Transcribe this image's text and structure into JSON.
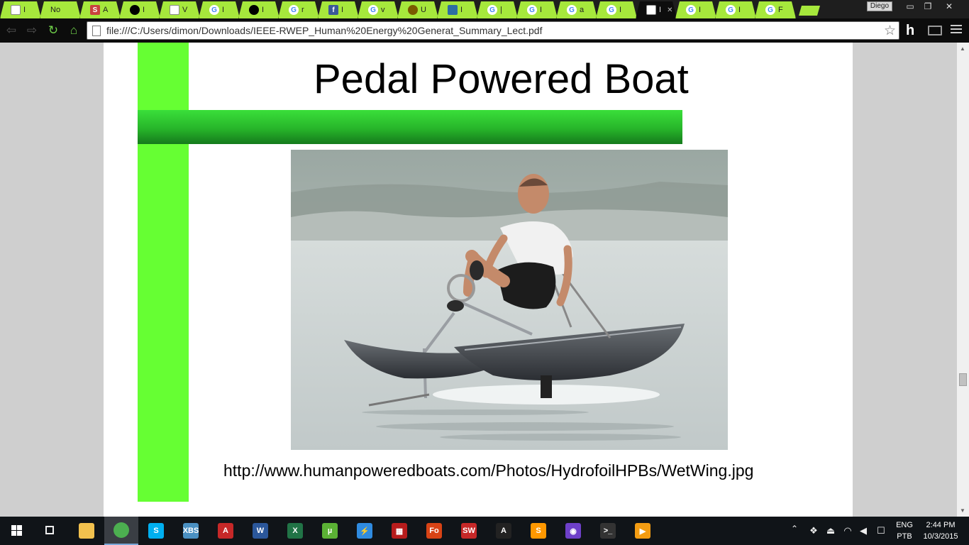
{
  "browser": {
    "tabs": [
      {
        "favicon": "document-icon",
        "title": "I"
      },
      {
        "favicon": "none",
        "title": "No"
      },
      {
        "favicon": "s-icon",
        "title": "A"
      },
      {
        "favicon": "github-icon",
        "title": "I"
      },
      {
        "favicon": "document-icon",
        "title": "V"
      },
      {
        "favicon": "google-icon",
        "title": "I"
      },
      {
        "favicon": "github-icon",
        "title": "I"
      },
      {
        "favicon": "google-icon",
        "title": "r"
      },
      {
        "favicon": "facebook-icon",
        "title": "I"
      },
      {
        "favicon": "google-icon",
        "title": "v"
      },
      {
        "favicon": "bug-icon",
        "title": "U"
      },
      {
        "favicon": "boat-icon",
        "title": "I"
      },
      {
        "favicon": "google-icon",
        "title": "|"
      },
      {
        "favicon": "google-icon",
        "title": "I"
      },
      {
        "favicon": "google-icon",
        "title": "a"
      },
      {
        "favicon": "google-icon",
        "title": "I"
      },
      {
        "favicon": "document-icon",
        "title": "I",
        "active": true
      },
      {
        "favicon": "google-icon",
        "title": "I"
      },
      {
        "favicon": "google-icon",
        "title": "I"
      },
      {
        "favicon": "google-icon",
        "title": "F"
      }
    ],
    "profile_name": "Diego",
    "address": "file:///C:/Users/dimon/Downloads/IEEE-RWEP_Human%20Energy%20Generat_Summary_Lect.pdf",
    "extension_label": "h"
  },
  "slide": {
    "title": "Pedal Powered Boat",
    "caption": "http://www.humanpoweredboats.com/Photos/HydrofoilHPBs/WetWing.jpg",
    "accent_green": "#66ff33",
    "bar_green": "#27b52a"
  },
  "taskbar": {
    "apps": [
      {
        "name": "file-explorer-icon",
        "color": "#f2c14e",
        "label": ""
      },
      {
        "name": "chrome-icon",
        "color": "#4caf50",
        "label": "",
        "active": true
      },
      {
        "name": "skype-icon",
        "color": "#00aff0",
        "label": "S"
      },
      {
        "name": "xbs-icon",
        "color": "#4a90c2",
        "label": "XBS"
      },
      {
        "name": "acrobat-icon",
        "color": "#c62828",
        "label": "A"
      },
      {
        "name": "word-icon",
        "color": "#2b579a",
        "label": "W"
      },
      {
        "name": "excel-icon",
        "color": "#217346",
        "label": "X"
      },
      {
        "name": "utorrent-icon",
        "color": "#5bb135",
        "label": "µ"
      },
      {
        "name": "lightning-icon",
        "color": "#2f8be0",
        "label": "⚡"
      },
      {
        "name": "checker-icon",
        "color": "#b71c1c",
        "label": "▦"
      },
      {
        "name": "foxit-icon",
        "color": "#d84315",
        "label": "Fo"
      },
      {
        "name": "solidworks-icon",
        "color": "#c62828",
        "label": "SW"
      },
      {
        "name": "autocad-icon",
        "color": "#222222",
        "label": "A"
      },
      {
        "name": "sublime-icon",
        "color": "#ff9800",
        "label": "S"
      },
      {
        "name": "github-desktop-icon",
        "color": "#6e40c9",
        "label": "◉"
      },
      {
        "name": "cmd-icon",
        "color": "#333333",
        "label": ">_"
      },
      {
        "name": "media-player-icon",
        "color": "#f39c12",
        "label": "▶"
      }
    ],
    "lang_top": "ENG",
    "lang_bottom": "PTB",
    "time": "2:44 PM",
    "date": "10/3/2015"
  }
}
